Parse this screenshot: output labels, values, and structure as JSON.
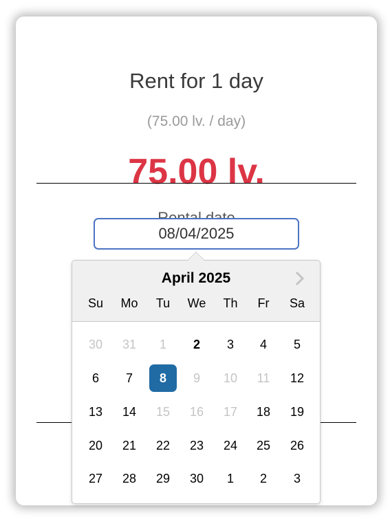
{
  "rental": {
    "title": "Rent for 1 day",
    "per_day": "(75.00 lv. / day)",
    "total": "75.00 lv.",
    "date_label": "Rental date",
    "date_value": "08/04/2025"
  },
  "calendar": {
    "month_label": "April 2025",
    "next_icon": "chevron-right-icon",
    "weekdays": [
      "Su",
      "Mo",
      "Tu",
      "We",
      "Th",
      "Fr",
      "Sa"
    ],
    "selected_color": "#216ba5",
    "weeks": [
      [
        {
          "d": "30",
          "s": "muted"
        },
        {
          "d": "31",
          "s": "muted"
        },
        {
          "d": "1",
          "s": "muted"
        },
        {
          "d": "2",
          "s": "bold"
        },
        {
          "d": "3",
          "s": ""
        },
        {
          "d": "4",
          "s": ""
        },
        {
          "d": "5",
          "s": ""
        }
      ],
      [
        {
          "d": "6",
          "s": ""
        },
        {
          "d": "7",
          "s": ""
        },
        {
          "d": "8",
          "s": "selected"
        },
        {
          "d": "9",
          "s": "muted"
        },
        {
          "d": "10",
          "s": "muted"
        },
        {
          "d": "11",
          "s": "muted"
        },
        {
          "d": "12",
          "s": ""
        }
      ],
      [
        {
          "d": "13",
          "s": ""
        },
        {
          "d": "14",
          "s": ""
        },
        {
          "d": "15",
          "s": "muted"
        },
        {
          "d": "16",
          "s": "muted"
        },
        {
          "d": "17",
          "s": "muted"
        },
        {
          "d": "18",
          "s": ""
        },
        {
          "d": "19",
          "s": ""
        }
      ],
      [
        {
          "d": "20",
          "s": ""
        },
        {
          "d": "21",
          "s": ""
        },
        {
          "d": "22",
          "s": ""
        },
        {
          "d": "23",
          "s": ""
        },
        {
          "d": "24",
          "s": ""
        },
        {
          "d": "25",
          "s": ""
        },
        {
          "d": "26",
          "s": ""
        }
      ],
      [
        {
          "d": "27",
          "s": ""
        },
        {
          "d": "28",
          "s": ""
        },
        {
          "d": "29",
          "s": ""
        },
        {
          "d": "30",
          "s": ""
        },
        {
          "d": "1",
          "s": ""
        },
        {
          "d": "2",
          "s": ""
        },
        {
          "d": "3",
          "s": ""
        }
      ]
    ]
  }
}
